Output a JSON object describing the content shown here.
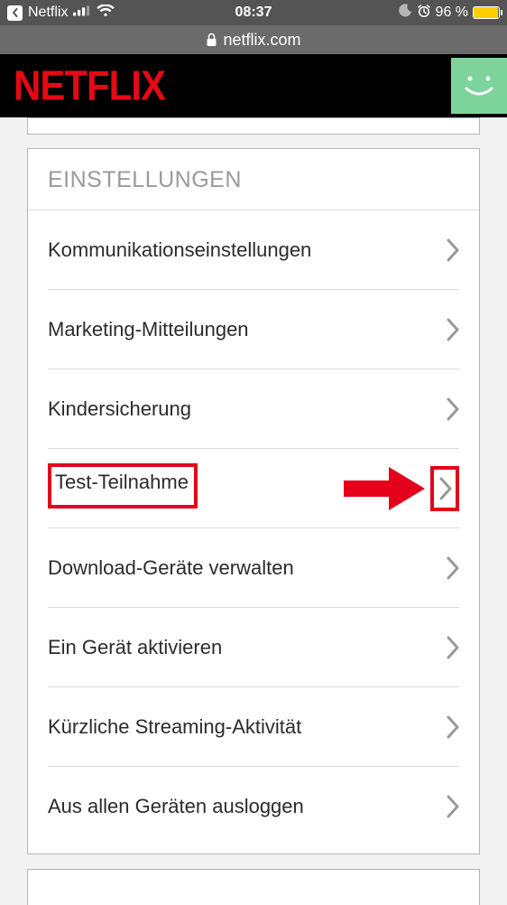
{
  "status_bar": {
    "app_name": "Netflix",
    "time": "08:37",
    "battery_text": "96 %",
    "battery_pct": 96
  },
  "browser": {
    "url": "netflix.com"
  },
  "header": {
    "brand": "NETFLIX"
  },
  "settings": {
    "title": "EINSTELLUNGEN",
    "items": [
      {
        "label": "Kommunikationseinstellungen"
      },
      {
        "label": "Marketing-Mitteilungen"
      },
      {
        "label": "Kindersicherung"
      },
      {
        "label": "Test-Teilnahme"
      },
      {
        "label": "Download-Geräte verwalten"
      },
      {
        "label": "Ein Gerät aktivieren"
      },
      {
        "label": "Kürzliche Streaming-Aktivität"
      },
      {
        "label": "Aus allen Geräten ausloggen"
      }
    ]
  }
}
